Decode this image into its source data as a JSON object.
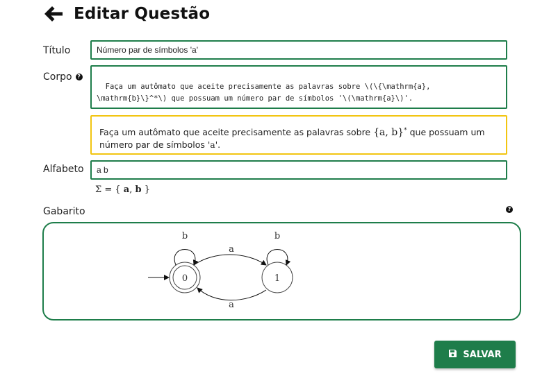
{
  "header": {
    "title": "Editar Questão",
    "back_icon": "arrow-left-icon"
  },
  "form": {
    "titulo": {
      "label": "Título",
      "value": "Número par de símbolos 'a'"
    },
    "corpo": {
      "label": "Corpo",
      "help_icon": "question-circle-icon",
      "value": "Faça um autômato que aceite precisamente as palavras sobre \\(\\{\\mathrm{a},\n\\mathrm{b}\\}^*\\) que possuam um número par de símbolos '\\(\\mathrm{a}\\)'."
    },
    "preview": {
      "text_before": "Faça um autômato que aceite precisamente as palavras sobre ",
      "math": "{a, b}",
      "math_sup": "*",
      "text_after_1": " que possuam um",
      "text_line2": "número par de símbolos '",
      "math_a": "a",
      "text_end": "'."
    },
    "alfabeto": {
      "label": "Alfabeto",
      "value": "a b",
      "sigma_prefix": "Σ = {",
      "sigma_a": "a",
      "sigma_sep": ",",
      "sigma_b": "b",
      "sigma_suffix": "}"
    },
    "gabarito": {
      "label": "Gabarito",
      "help_icon": "question-circle-icon",
      "automaton": {
        "states": [
          "0",
          "1"
        ],
        "initial": "0",
        "accepting": [
          "0"
        ],
        "transitions": [
          {
            "from": "0",
            "to": "0",
            "symbol": "b"
          },
          {
            "from": "0",
            "to": "1",
            "symbol": "a"
          },
          {
            "from": "1",
            "to": "1",
            "symbol": "b"
          },
          {
            "from": "1",
            "to": "0",
            "symbol": "a"
          }
        ]
      }
    }
  },
  "actions": {
    "save_label": "SALVAR",
    "save_icon": "floppy-disk-icon"
  },
  "colors": {
    "accent": "#1e7d4a",
    "preview_border": "#f2c511"
  }
}
